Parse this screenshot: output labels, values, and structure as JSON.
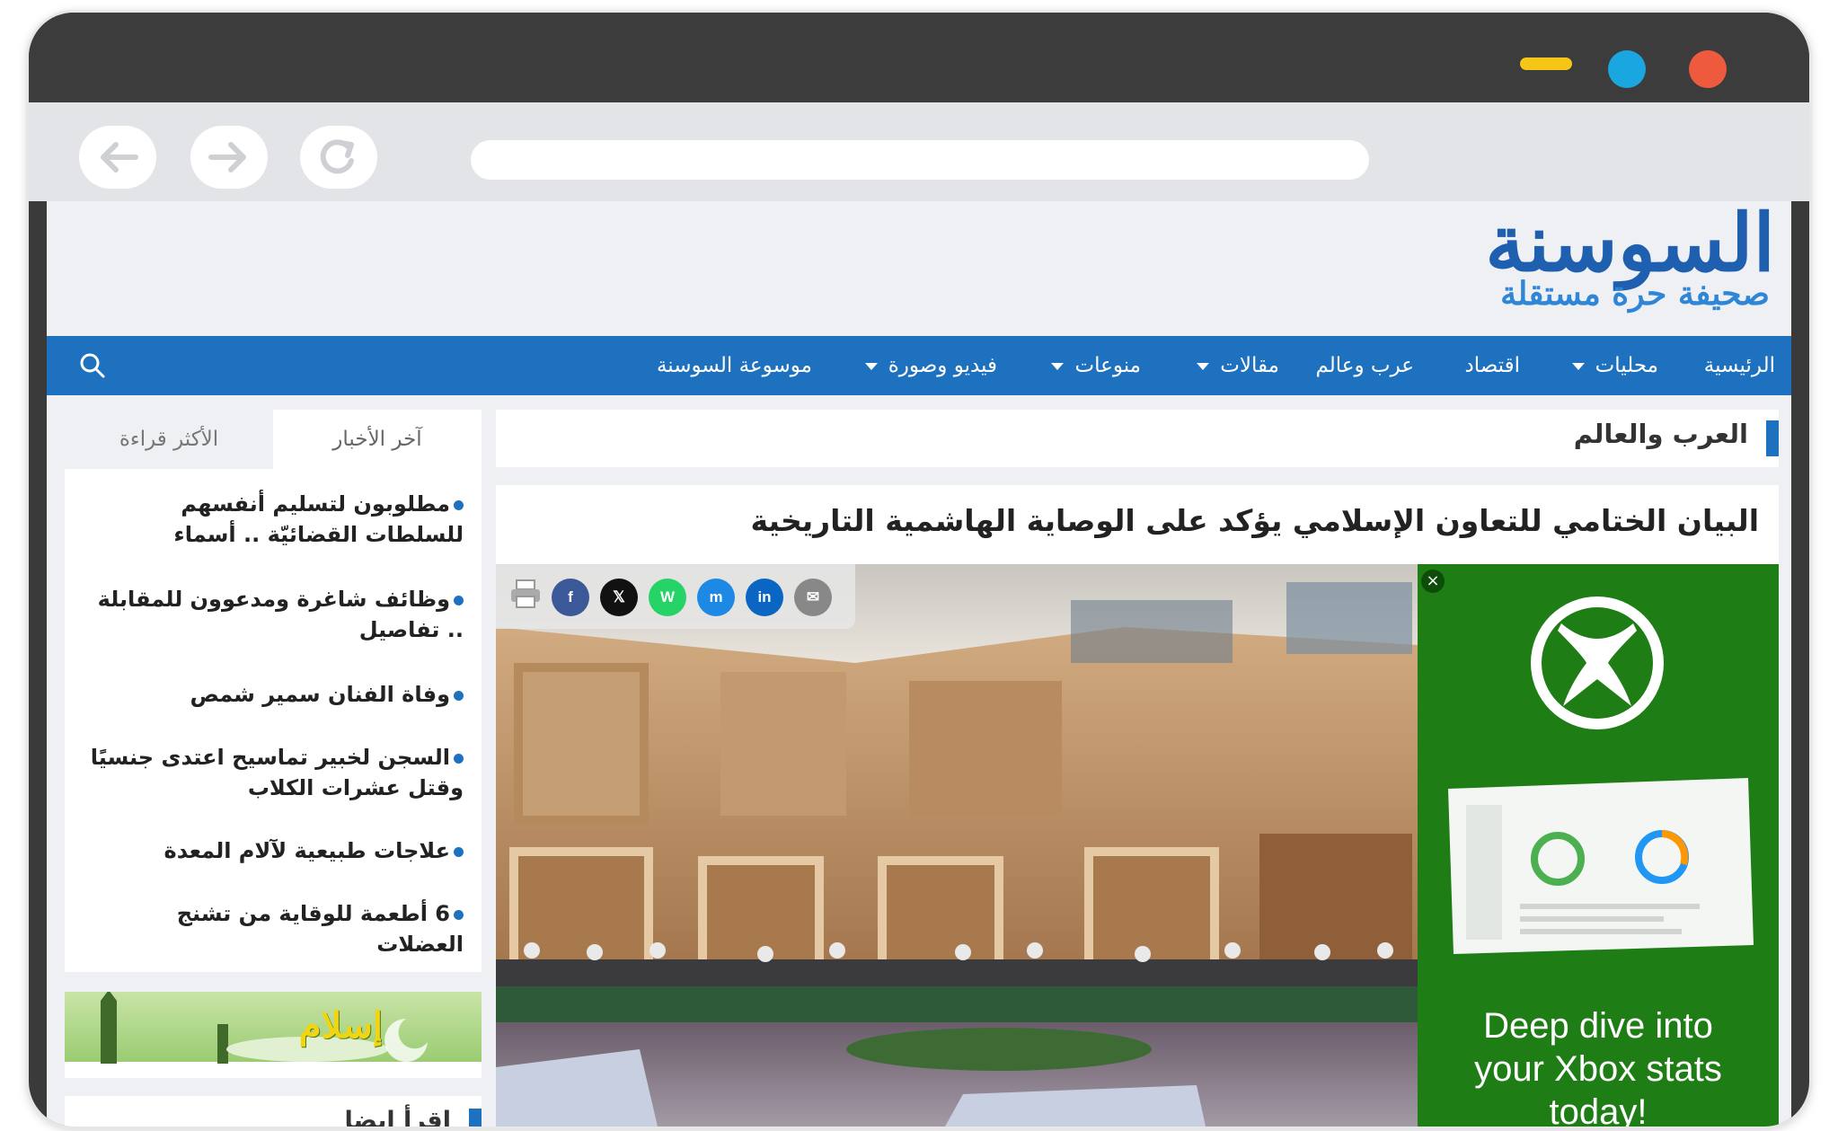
{
  "site": {
    "logo": "السوسنة",
    "tagline": "صحيفة حرة مستقلة"
  },
  "nav": {
    "items": [
      {
        "label": "الرئيسية",
        "dropdown": false
      },
      {
        "label": "محليات",
        "dropdown": true
      },
      {
        "label": "اقتصاد",
        "dropdown": false
      },
      {
        "label": "عرب وعالم",
        "dropdown": false
      },
      {
        "label": "مقالات",
        "dropdown": true
      },
      {
        "label": "منوعات",
        "dropdown": true
      },
      {
        "label": "فيديو وصورة",
        "dropdown": true
      },
      {
        "label": "موسوعة السوسنة",
        "dropdown": false
      }
    ],
    "search_icon": "search-icon"
  },
  "section": {
    "title": "العرب والعالم"
  },
  "article": {
    "headline": "البيان الختامي للتعاون الإسلامي يؤكد على الوصاية الهاشمية التاريخية",
    "share": [
      {
        "name": "print",
        "icon": "printer-icon"
      },
      {
        "name": "facebook",
        "label": "f",
        "color": "#3b5998"
      },
      {
        "name": "x",
        "label": "𝕏",
        "color": "#111111"
      },
      {
        "name": "whatsapp",
        "label": "W",
        "color": "#25d366"
      },
      {
        "name": "messenger",
        "label": "m",
        "color": "#1e88e5"
      },
      {
        "name": "linkedin",
        "label": "in",
        "color": "#0a66c2"
      },
      {
        "name": "email",
        "label": "✉",
        "color": "#888888"
      }
    ]
  },
  "ad": {
    "close": "×",
    "line1": "Deep dive into",
    "line2": "your Xbox stats",
    "line3": "today!",
    "brand_color": "#1e7d15"
  },
  "sidebar": {
    "tabs": {
      "latest": "آخر الأخبار",
      "most_read": "الأكثر قراءة"
    },
    "news": [
      "مطلوبون لتسليم أنفسهم للسلطات القضائيّة .. أسماء",
      "وظائف شاغرة ومدعوون للمقابلة .. تفاصيل",
      "وفاة الفنان سمير شمص",
      "السجن لخبير تماسيح اعتدى جنسيًا وقتل عشرات الكلاب",
      "علاجات طبيعية لآلام المعدة",
      "6 أطعمة للوقاية من تشنج العضلات"
    ],
    "banner_text": "إسلام",
    "read_also": "إقرأ ايضا"
  },
  "colors": {
    "nav_blue": "#1d71be",
    "logo_blue": "#1f5fb0",
    "page_bg": "#eef0f4"
  }
}
